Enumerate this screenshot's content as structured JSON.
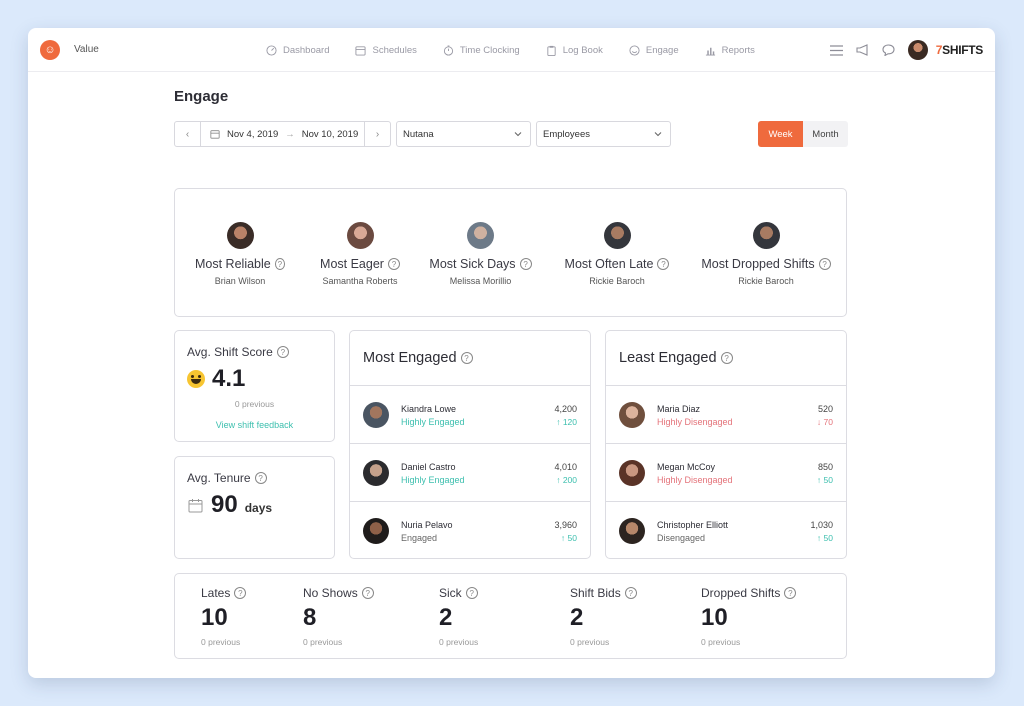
{
  "topbar": {
    "location": "Value",
    "nav": [
      {
        "label": "Dashboard",
        "icon": "dashboard-icon"
      },
      {
        "label": "Schedules",
        "icon": "calendar-icon"
      },
      {
        "label": "Time Clocking",
        "icon": "clock-icon"
      },
      {
        "label": "Log Book",
        "icon": "clipboard-icon"
      },
      {
        "label": "Engage",
        "icon": "smile-icon"
      },
      {
        "label": "Reports",
        "icon": "bar-chart-icon"
      }
    ],
    "brand_seven": "7",
    "brand_rest": "SHIFTS"
  },
  "page": {
    "title": "Engage"
  },
  "filters": {
    "start_date": "Nov 4, 2019",
    "end_date": "Nov 10, 2019",
    "location": "Nutana",
    "group": "Employees",
    "week_label": "Week",
    "month_label": "Month"
  },
  "awards": [
    {
      "title": "Most Reliable",
      "name": "Brian Wilson"
    },
    {
      "title": "Most Eager",
      "name": "Samantha Roberts"
    },
    {
      "title": "Most Sick Days",
      "name": "Melissa Morillio"
    },
    {
      "title": "Most Often Late",
      "name": "Rickie Baroch"
    },
    {
      "title": "Most Dropped Shifts",
      "name": "Rickie Baroch"
    }
  ],
  "shift_score": {
    "title": "Avg. Shift Score",
    "value": "4.1",
    "previous": "0 previous",
    "link": "View shift feedback"
  },
  "tenure": {
    "title": "Avg. Tenure",
    "value": "90",
    "unit": "days"
  },
  "most_engaged": {
    "title": "Most Engaged",
    "rows": [
      {
        "name": "Kiandra Lowe",
        "status": "Highly Engaged",
        "score": "4,200",
        "delta": "↑ 120"
      },
      {
        "name": "Daniel Castro",
        "status": "Highly Engaged",
        "score": "4,010",
        "delta": "↑ 200"
      },
      {
        "name": "Nuria Pelavo",
        "status": "Engaged",
        "score": "3,960",
        "delta": "↑ 50"
      }
    ]
  },
  "least_engaged": {
    "title": "Least Engaged",
    "rows": [
      {
        "name": "Maria Diaz",
        "status": "Highly Disengaged",
        "score": "520",
        "delta": "↓ 70"
      },
      {
        "name": "Megan McCoy",
        "status": "Highly Disengaged",
        "score": "850",
        "delta": "↑ 50"
      },
      {
        "name": "Christopher Elliott",
        "status": "Disengaged",
        "score": "1,030",
        "delta": "↑ 50"
      }
    ]
  },
  "bottom_stats": [
    {
      "label": "Lates",
      "value": "10",
      "previous": "0 previous"
    },
    {
      "label": "No Shows",
      "value": "8",
      "previous": "0 previous"
    },
    {
      "label": "Sick",
      "value": "2",
      "previous": "0 previous"
    },
    {
      "label": "Shift Bids",
      "value": "2",
      "previous": "0 previous"
    },
    {
      "label": "Dropped Shifts",
      "value": "10",
      "previous": "0 previous"
    }
  ],
  "colors": {
    "accent": "#ef6a3d",
    "positive": "#3cbfae",
    "negative": "#e4737a",
    "background": "#dbe9fb"
  }
}
